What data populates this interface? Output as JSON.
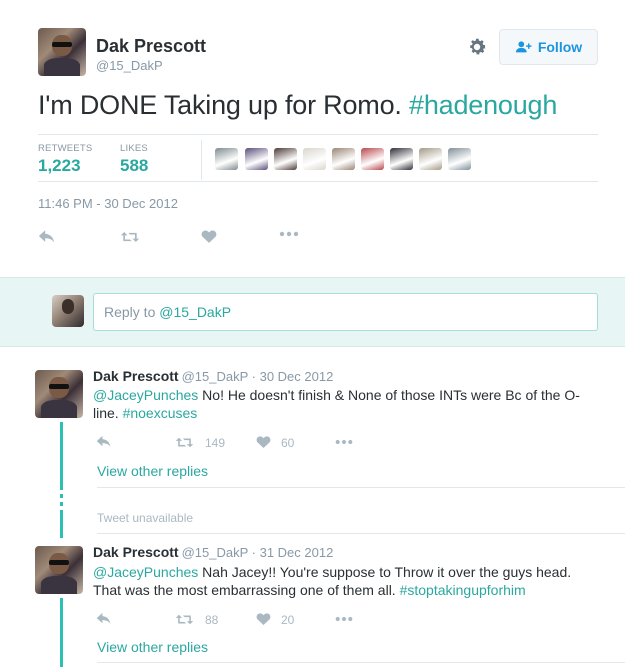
{
  "tweet": {
    "author_name": "Dak Prescott",
    "author_handle": "@15_DakP",
    "follow_label": "Follow",
    "text_main": "I'm DONE Taking up for Romo. ",
    "text_hashtag": "#hadenough",
    "retweets_label": "RETWEETS",
    "retweets_value": "1,223",
    "likes_label": "LIKES",
    "likes_value": "588",
    "timestamp": "11:46 PM - 30 Dec 2012",
    "liker_colors": [
      "#7d8a8e",
      "#5a4f7a",
      "#4b3a36",
      "#d9d6cc",
      "#9a8574",
      "#b8474c",
      "#2e2f38",
      "#a39a86",
      "#7f8f98"
    ]
  },
  "reply_composer": {
    "prefix": "Reply to ",
    "handle": "@15_DakP"
  },
  "replies": [
    {
      "name": "Dak Prescott",
      "meta": "@15_DakP · 30 Dec 2012",
      "mention": "@JaceyPunches",
      "text": " No! He doesn't finish & None of those INTs were Bc of the O-line. ",
      "hashtag": "#noexcuses",
      "retweets": "149",
      "likes": "60",
      "view_more": "View other replies"
    },
    {
      "name": "Dak Prescott",
      "meta": "@15_DakP · 31 Dec 2012",
      "mention": "@JaceyPunches",
      "text": " Nah Jacey!! You're suppose to Throw it over the guys head. That was the most embarrassing one of them all. ",
      "hashtag": "#stoptakingupforhim",
      "retweets": "88",
      "likes": "20",
      "view_more": "View other replies"
    }
  ],
  "tweet_unavailable": "Tweet unavailable",
  "colors": {
    "accent": "#2aa8a0",
    "follow_blue": "#1b95e0",
    "muted": "#8899a6",
    "thread_line": "#2cc0b4"
  }
}
